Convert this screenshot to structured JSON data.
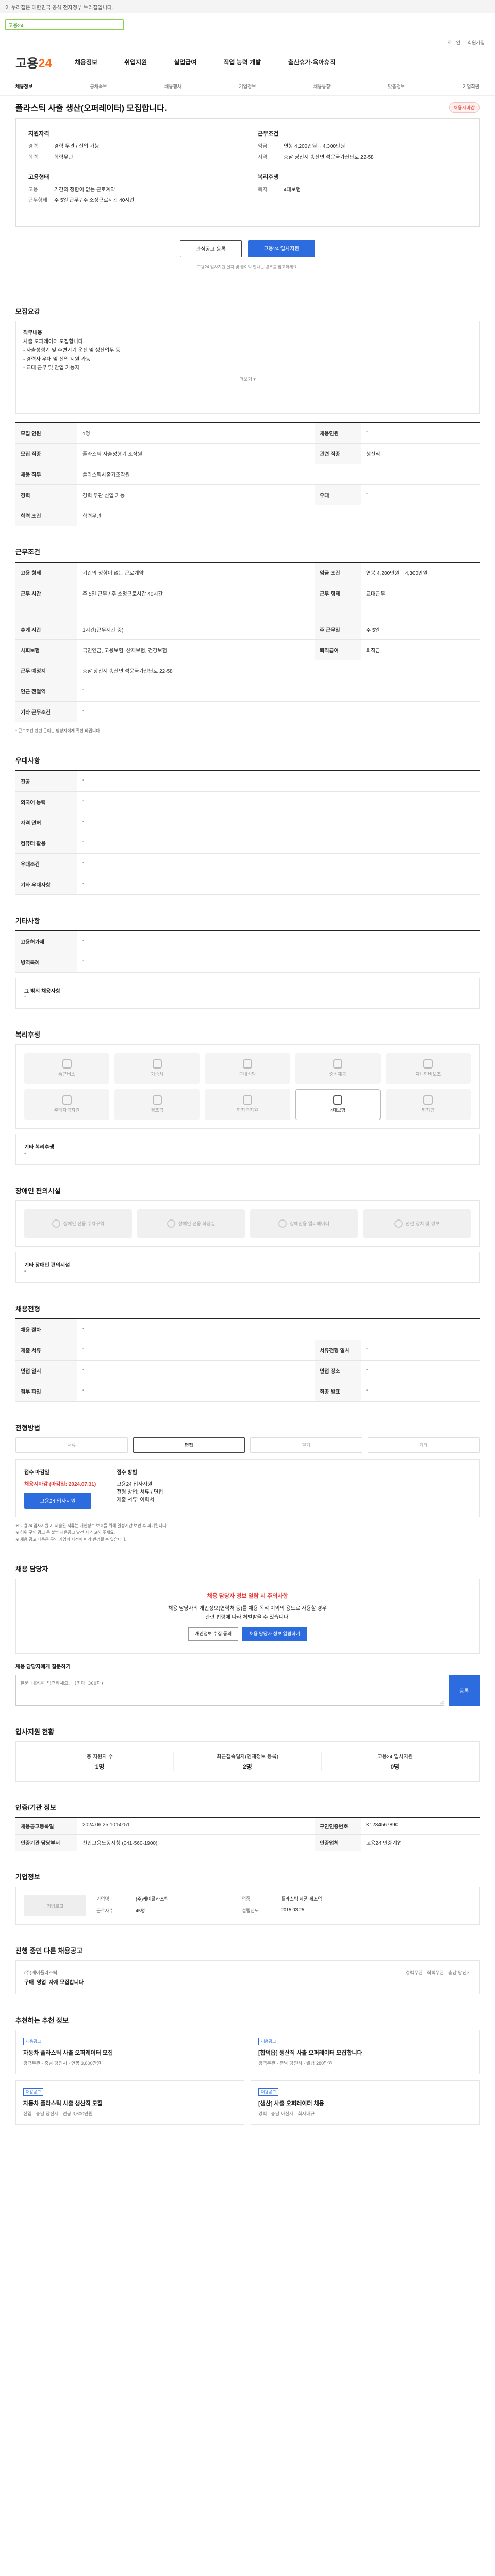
{
  "gov_bar": "이 누리집은 대한민국 공식 전자정부 누리집입니다.",
  "search": {
    "value": "고용24"
  },
  "util": [
    "로그인",
    "회원가입"
  ],
  "logo": {
    "main": "고용",
    "accent": "24"
  },
  "gnb": [
    "채용정보",
    "취업지원",
    "실업급여",
    "직업 능력 개발",
    "출산휴가·육아휴직"
  ],
  "subnav": [
    "채용정보",
    "공채속보",
    "채용행사",
    "기업정보",
    "채용동향",
    "맞춤정보",
    "기업회원"
  ],
  "title": "플라스틱 사출 생산(오퍼레이터) 모집합니다.",
  "badge": "채용시마감",
  "summary": {
    "g1_title": "지원자격",
    "g1": [
      [
        "경력",
        "경력 무관 / 신입 가능"
      ],
      [
        "학력",
        "학력무관"
      ]
    ],
    "g2_title": "근무조건",
    "g2": [
      [
        "임금",
        "연봉 4,200만원 ~ 4,300만원"
      ],
      [
        "지역",
        "충남 당진시 송산면 석문국가산단로 22-58"
      ]
    ],
    "g3_title": "고용형태",
    "g3": [
      [
        "고용",
        "기간의 정함이 없는 근로계약"
      ],
      [
        "근무형태",
        "주 5일 근무 / 주 소정근로시간 40시간"
      ]
    ],
    "g4_title": "복리후생",
    "g4": [
      [
        "복지",
        "4대보험"
      ]
    ]
  },
  "actions": {
    "save": "관심공고 등록",
    "apply": "고용24 입사지원"
  },
  "actions_note": "고용24 입사지원 절차 및 불이익 안내는 링크를 참고하세요.",
  "sec_recruit": {
    "title": "모집요강",
    "desc_title": "직무내용",
    "desc": [
      "사출 오퍼레이터 모집합니다.",
      "- 사출성형기 및 주변기기 운전 및 생산업무 등",
      "- 경력자 우대 및 신입 지원 가능",
      "- 교대 근무 및 잔업 가능자"
    ],
    "more": "더보기 ▾",
    "rows": [
      [
        "모집 인원",
        "1명",
        "채용인원",
        "-"
      ],
      [
        "모집 직종",
        "플라스틱 사출성형기 조작원",
        "관련 직종",
        "생산직"
      ],
      [
        "채용 직무",
        "플라스틱사출기조작원",
        "",
        ""
      ],
      [
        "경력",
        "경력 무관 신입 가능",
        "우대",
        "-"
      ],
      [
        "학력 조건",
        "학력무관",
        "",
        ""
      ]
    ]
  },
  "sec_work": {
    "title": "근무조건",
    "rows": [
      [
        "고용 형태",
        "기간의 정함이 없는 근로계약",
        "임금 조건",
        "연봉 4,200만원 ~ 4,300만원"
      ],
      [
        "근무 시간",
        "주 5일 근무 / 주 소정근로시간 40시간",
        "근무 형태",
        "교대근무"
      ],
      [
        "휴게 시간",
        "1시간(근무시간 중)",
        "주 근무일",
        "주 5일"
      ],
      [
        "사회보험",
        "국민연금, 고용보험, 산재보험, 건강보험",
        "퇴직급여",
        "퇴직금"
      ],
      [
        "근무 예정지",
        "충남 당진시 송산면 석문국가산단로 22-58",
        "",
        ""
      ],
      [
        "인근 전철역",
        "-",
        "",
        ""
      ],
      [
        "기타 근무조건",
        "-",
        "",
        ""
      ]
    ],
    "note": "* 근로조건 관련 문의는 담당자에게 확인 바랍니다."
  },
  "sec_qual": {
    "title": "우대사항",
    "rows": [
      [
        "전공",
        "-"
      ],
      [
        "외국어 능력",
        "-"
      ],
      [
        "자격 면허",
        "-"
      ],
      [
        "컴퓨터 활용",
        "-"
      ],
      [
        "우대조건",
        "-"
      ],
      [
        "기타 우대사항",
        "-"
      ]
    ]
  },
  "sec_etc": {
    "title": "기타사항",
    "rows": [
      [
        "고용허가제",
        "-"
      ],
      [
        "병역특례",
        "-"
      ]
    ],
    "box_title": "그 밖의 채용사항",
    "box": "-"
  },
  "sec_welfare": {
    "title": "복리후생",
    "items": [
      "통근버스",
      "기숙사",
      "구내식당",
      "중식제공",
      "자녀학비보조",
      "주택자금지원",
      "경조금",
      "학자금지원",
      "4대보험",
      "퇴직금"
    ],
    "box_title": "기타 복리후생",
    "box": "-"
  },
  "sec_disab": {
    "title": "장애인 편의시설",
    "items": [
      "장애인 전용 주차구역",
      "장애인 전용 화장실",
      "장애인용 엘리베이터",
      "안전 장치 및 경보"
    ],
    "box_title": "기타 장애인 편의시설",
    "box": "-"
  },
  "sec_proc": {
    "title": "채용전형",
    "rows": [
      [
        "채용 절차",
        "-",
        "",
        ""
      ],
      [
        "제출 서류",
        "-",
        "서류전형 일시",
        "-"
      ],
      [
        "면접 일시",
        "-",
        "면접 장소",
        "-"
      ],
      [
        "첨부 파일",
        "-",
        "최종 발표",
        "-"
      ]
    ]
  },
  "sec_method": {
    "title": "전형방법",
    "steps": [
      "서류",
      "면접",
      "필기",
      "기타"
    ],
    "col1_title": "접수 마감일",
    "col1_v": "채용시마감 (마감일: 2024.07.31)",
    "col1_btn": "고용24 입사지원",
    "col2_title": "접수 방법",
    "col2": [
      "고용24 입사지원",
      "전형 방법: 서류 / 면접",
      "제출 서류: 이력서"
    ],
    "notes": [
      "※ 고용24 입사지원 시 제출된 서류는 개인정보 보호를 위해 일정기간 보관 후 파기됩니다.",
      "※ 허위 구인 광고 등 불법 채용공고 발견 시 신고해 주세요.",
      "※ 채용 공고 내용은 구인 기업의 사정에 따라 변경될 수 있습니다."
    ]
  },
  "sec_contact": {
    "title": "채용 담당자",
    "warn_title": "채용 담당자 정보 열람 시 주의사항",
    "warn": [
      "채용 담당자의 개인정보(연락처 등)를 채용 목적 이외의 용도로 사용할 경우",
      "관련 법령에 따라 처벌받을 수 있습니다."
    ],
    "btn1": "개인정보 수집 동의",
    "btn2": "채용 담당자 정보 열람하기",
    "qa_title": "채용 담당자에게 질문하기",
    "qa_placeholder": "질문 내용을 입력하세요. (최대 300자)",
    "qa_btn": "등록"
  },
  "sec_stats": {
    "title": "입사지원 현황",
    "items": [
      [
        "총 지원자 수",
        "1명"
      ],
      [
        "최근접속일자(인재정보 등록)",
        "2명"
      ],
      [
        "고용24 입사지원",
        "0명"
      ]
    ]
  },
  "sec_info": {
    "title": "인증/기관 정보",
    "rows": [
      [
        "채용공고등록일",
        "2024.06.25 10:50:51",
        "구인인증번호",
        "K1234567890"
      ],
      [
        "인증기관 담당부서",
        "천안고용노동지청 (041-560-1900)",
        "인증업체",
        "고용24 인증기업"
      ]
    ]
  },
  "sec_corp": {
    "title": "기업정보",
    "logo": "기업로고",
    "fields": [
      [
        "기업명",
        "(주)케이플라스틱"
      ],
      [
        "업종",
        "플라스틱 제품 제조업"
      ],
      [
        "근로자수",
        "45명"
      ],
      [
        "설립년도",
        "2015.03.25"
      ]
    ]
  },
  "sec_other": {
    "title": "진행 중인 다른 채용공고",
    "company": "(주)케이플라스틱",
    "post": "구매_영업_자재 모집합니다",
    "meta": "경력무관 · 학력무관 · 충남 당진시"
  },
  "sec_similar": {
    "title": "추천하는 추천 정보",
    "cards": [
      {
        "tag": "채용공고",
        "title": "자동차 플라스틱 사출 오퍼레이터 모집",
        "meta": "경력무관 · 충남 당진시 · 연봉 3,800만원"
      },
      {
        "tag": "채용공고",
        "title": "[합덕읍] 생산직 사출 오퍼레이터 모집합니다",
        "meta": "경력무관 · 충남 당진시 · 월급 280만원"
      },
      {
        "tag": "채용공고",
        "title": "자동차 플라스틱 사출 생산직 모집",
        "meta": "신입 · 충남 당진시 · 연봉 3,600만원"
      },
      {
        "tag": "채용공고",
        "title": "[생산] 사출 오퍼레이터 채용",
        "meta": "경력 · 충남 아산시 · 회사내규"
      }
    ]
  }
}
